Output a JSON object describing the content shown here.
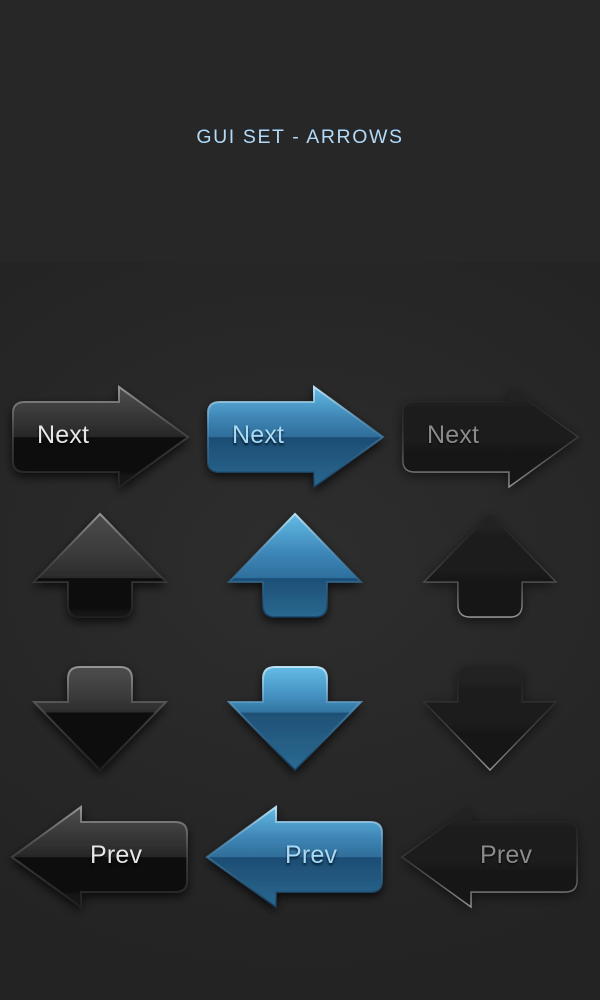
{
  "header": {
    "title": "GUI SET - ARROWS",
    "bg_top_color": "#31679e",
    "bg_bottom_color": "#4da0db",
    "title_color": "#b5d9f2"
  },
  "board": {
    "background_color": "#272727"
  },
  "palette": {
    "dark_glossy_top": "#4a4a4a",
    "dark_glossy_bottom": "#0b0b0b",
    "blue_glossy_top": "#59b4e0",
    "blue_glossy_bottom": "#1c4a73",
    "flat_dark": "#1d1d1d",
    "label_dark": "#e6e6e6",
    "label_blue": "#a9daf3",
    "label_flat": "#8b8b8b"
  },
  "buttons": [
    {
      "id": "next-dark",
      "label": "Next",
      "direction": "right",
      "style": "dark-glossy"
    },
    {
      "id": "next-blue",
      "label": "Next",
      "direction": "right",
      "style": "blue-glossy"
    },
    {
      "id": "next-flat",
      "label": "Next",
      "direction": "right",
      "style": "flat-dark"
    },
    {
      "id": "up-dark",
      "label": "",
      "direction": "up",
      "style": "dark-glossy"
    },
    {
      "id": "up-blue",
      "label": "",
      "direction": "up",
      "style": "blue-glossy"
    },
    {
      "id": "up-flat",
      "label": "",
      "direction": "up",
      "style": "flat-dark"
    },
    {
      "id": "down-dark",
      "label": "",
      "direction": "down",
      "style": "dark-glossy"
    },
    {
      "id": "down-blue",
      "label": "",
      "direction": "down",
      "style": "blue-glossy"
    },
    {
      "id": "down-flat",
      "label": "",
      "direction": "down",
      "style": "flat-dark"
    },
    {
      "id": "prev-dark",
      "label": "Prev",
      "direction": "left",
      "style": "dark-glossy"
    },
    {
      "id": "prev-blue",
      "label": "Prev",
      "direction": "left",
      "style": "blue-glossy"
    },
    {
      "id": "prev-flat",
      "label": "Prev",
      "direction": "left",
      "style": "flat-dark"
    }
  ]
}
